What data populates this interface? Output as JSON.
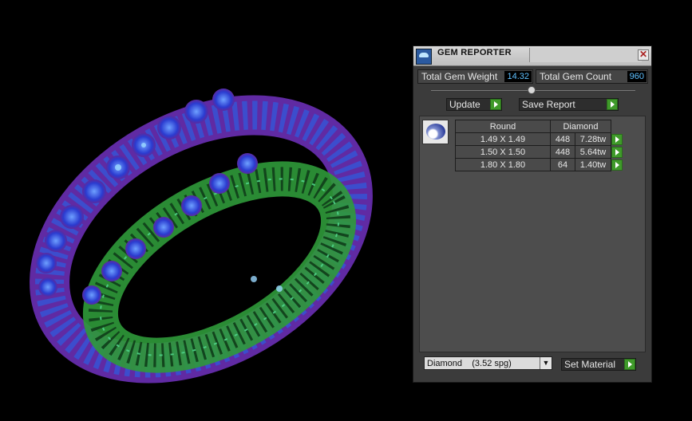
{
  "panel": {
    "title": "GEM REPORTER",
    "close_glyph": "✕",
    "total_weight_label": "Total Gem Weight",
    "total_weight_value": "14.32",
    "total_count_label": "Total Gem Count",
    "total_count_value": "960",
    "update_label": "Update",
    "save_report_label": "Save Report",
    "table": {
      "header_shape": "Round",
      "header_material": "Diamond",
      "rows": [
        {
          "size": "1.49 X 1.49",
          "count": "448",
          "weight": "7.28tw"
        },
        {
          "size": "1.50 X 1.50",
          "count": "448",
          "weight": "5.64tw"
        },
        {
          "size": "1.80 X 1.80",
          "count": "64",
          "weight": "1.40tw"
        }
      ]
    },
    "material_select": "Diamond    (3.52 spg)",
    "set_material_label": "Set Material"
  },
  "colors": {
    "accent_blue": "#5ec0ff",
    "button_green": "#3f9a2a",
    "panel_bg": "#3b3b3b"
  },
  "icons": {
    "app": "gem-reporter-app-icon",
    "gem": "round-diamond-icon",
    "close": "close-icon",
    "action": "green-play-arrow-icon",
    "dropdown": "chevron-down-icon"
  }
}
